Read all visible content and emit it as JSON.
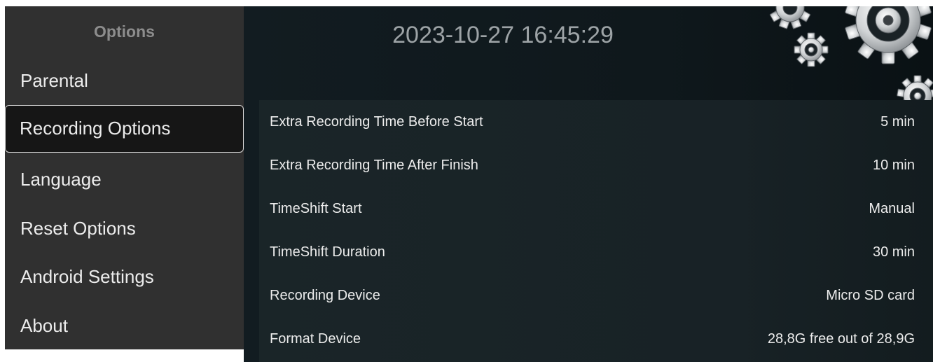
{
  "sidebar": {
    "title": "Options",
    "items": [
      {
        "label": "Parental",
        "selected": false
      },
      {
        "label": "Recording Options",
        "selected": true
      },
      {
        "label": "Language",
        "selected": false
      },
      {
        "label": "Reset Options",
        "selected": false
      },
      {
        "label": "Android Settings",
        "selected": false
      },
      {
        "label": "About",
        "selected": false
      }
    ]
  },
  "header": {
    "datetime": "2023-10-27 16:45:29",
    "decoration_icon": "gears-icon"
  },
  "settings": [
    {
      "label": "Extra Recording Time Before Start",
      "value": "5 min"
    },
    {
      "label": "Extra Recording Time After Finish",
      "value": "10 min"
    },
    {
      "label": "TimeShift Start",
      "value": "Manual"
    },
    {
      "label": "TimeShift Duration",
      "value": "30 min"
    },
    {
      "label": "Recording Device",
      "value": "Micro SD card"
    },
    {
      "label": "Format Device",
      "value": "28,8G free out of 28,9G"
    }
  ],
  "colors": {
    "sidebar_bg": "#303030",
    "selected_bg": "#161616",
    "selected_border": "#d8d8d8",
    "main_bg": "#121c21",
    "text": "#ececec",
    "header_text": "#8d8d8d"
  }
}
